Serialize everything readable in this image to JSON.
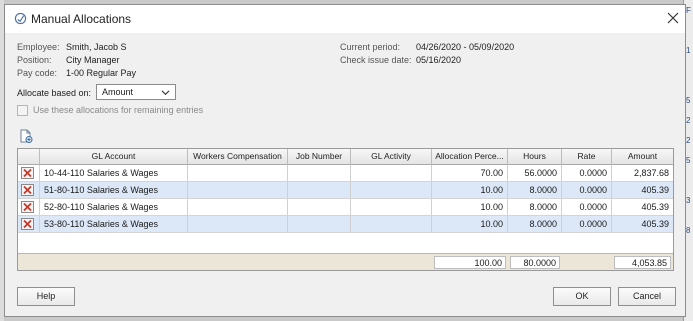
{
  "dialog": {
    "title": "Manual Allocations"
  },
  "info": {
    "employee_label": "Employee:",
    "employee_value": "Smith, Jacob S",
    "position_label": "Position:",
    "position_value": "City Manager",
    "paycode_label": "Pay code:",
    "paycode_value": "1-00 Regular Pay",
    "period_label": "Current period:",
    "period_value": "04/26/2020 - 05/09/2020",
    "checkdate_label": "Check issue date:",
    "checkdate_value": "05/16/2020"
  },
  "allocate": {
    "label": "Allocate based on:",
    "selected": "Amount"
  },
  "remaining_checkbox": {
    "label": "Use these allocations for remaining entries",
    "checked": false
  },
  "grid": {
    "columns": [
      "GL Account",
      "Workers Compensation",
      "Job Number",
      "GL Activity",
      "Allocation Perce...",
      "Hours",
      "Rate",
      "Amount"
    ],
    "rows": [
      {
        "gl_account": "10-44-110 Salaries & Wages",
        "workers_comp": "",
        "job_number": "",
        "gl_activity": "",
        "alloc_pct": "70.00",
        "hours": "56.0000",
        "rate": "0.0000",
        "amount": "2,837.68"
      },
      {
        "gl_account": "51-80-110 Salaries & Wages",
        "workers_comp": "",
        "job_number": "",
        "gl_activity": "",
        "alloc_pct": "10.00",
        "hours": "8.0000",
        "rate": "0.0000",
        "amount": "405.39"
      },
      {
        "gl_account": "52-80-110 Salaries & Wages",
        "workers_comp": "",
        "job_number": "",
        "gl_activity": "",
        "alloc_pct": "10.00",
        "hours": "8.0000",
        "rate": "0.0000",
        "amount": "405.39"
      },
      {
        "gl_account": "53-80-110 Salaries & Wages",
        "workers_comp": "",
        "job_number": "",
        "gl_activity": "",
        "alloc_pct": "10.00",
        "hours": "8.0000",
        "rate": "0.0000",
        "amount": "405.39"
      }
    ],
    "totals": {
      "alloc_pct": "100.00",
      "hours": "80.0000",
      "amount": "4,053.85"
    }
  },
  "buttons": {
    "help": "Help",
    "ok": "OK",
    "cancel": "Cancel"
  },
  "background": {
    "left_chars": [
      "ic",
      "ni"
    ],
    "right_numbers": [
      "F",
      "1",
      "5",
      "2",
      "2",
      "5",
      "3",
      "8"
    ]
  },
  "colors": {
    "row_alt": "#dce8f8",
    "totals_bar": "#ece6d8",
    "delete_x": "#c0392b"
  }
}
